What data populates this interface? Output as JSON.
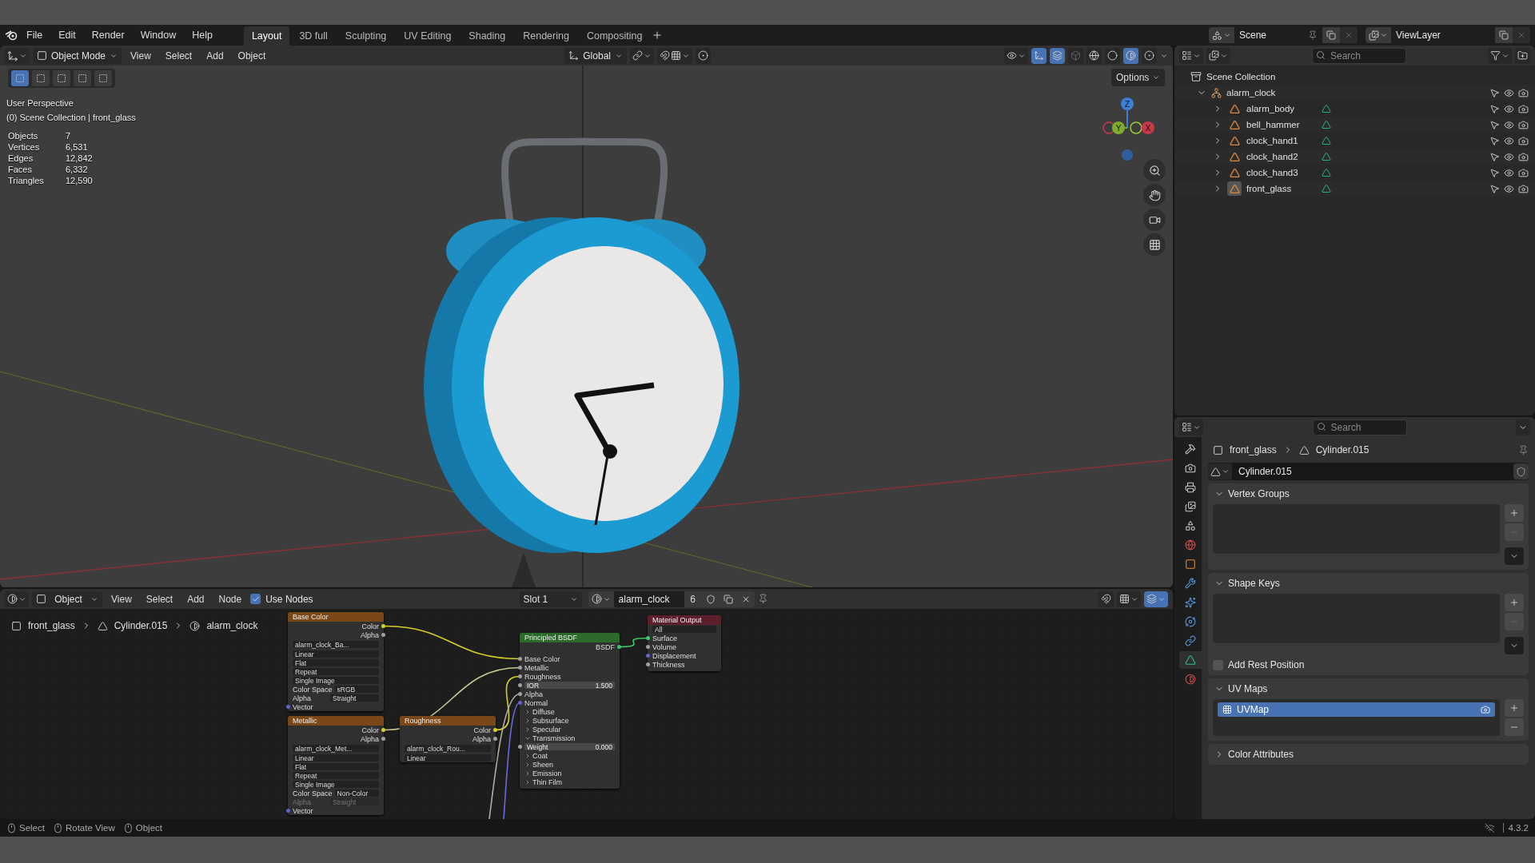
{
  "menu": [
    "File",
    "Edit",
    "Render",
    "Window",
    "Help"
  ],
  "workspaces": [
    {
      "label": "Layout",
      "selected": true
    },
    {
      "label": "3D full",
      "selected": false
    },
    {
      "label": "Sculpting",
      "selected": false
    },
    {
      "label": "UV Editing",
      "selected": false
    },
    {
      "label": "Shading",
      "selected": false
    },
    {
      "label": "Rendering",
      "selected": false
    },
    {
      "label": "Compositing",
      "selected": false
    }
  ],
  "scene": "Scene",
  "view_layer": "ViewLayer",
  "viewport": {
    "mode": "Object Mode",
    "menus": [
      "View",
      "Select",
      "Add",
      "Object"
    ],
    "orientation": "Global",
    "options": "Options",
    "perspective": "User Perspective",
    "context": "(0) Scene Collection | front_glass",
    "select_modes": [
      {
        "selected": true
      },
      {
        "selected": false
      },
      {
        "selected": false
      },
      {
        "selected": false
      },
      {
        "selected": false
      }
    ],
    "shading": [
      {
        "kind": "wireframe",
        "selected": false
      },
      {
        "kind": "solid",
        "selected": false
      },
      {
        "kind": "material",
        "selected": true
      },
      {
        "kind": "rendered",
        "selected": false
      }
    ],
    "stats": [
      {
        "label": "Objects",
        "value": "7"
      },
      {
        "label": "Vertices",
        "value": "6,531"
      },
      {
        "label": "Edges",
        "value": "12,842"
      },
      {
        "label": "Faces",
        "value": "6,332"
      },
      {
        "label": "Triangles",
        "value": "12,590"
      }
    ],
    "gizmo": {
      "z": "Z",
      "y": "Y",
      "x": "X"
    }
  },
  "outliner": {
    "search_placeholder": "Search",
    "root": "Scene Collection",
    "collection": {
      "name": "alarm_clock",
      "expanded": true,
      "children": [
        {
          "name": "alarm_body",
          "expanded": false,
          "selected": false
        },
        {
          "name": "bell_hammer",
          "expanded": false,
          "selected": false
        },
        {
          "name": "clock_hand1",
          "expanded": false,
          "selected": false
        },
        {
          "name": "clock_hand2",
          "expanded": false,
          "selected": false
        },
        {
          "name": "clock_hand3",
          "expanded": false,
          "selected": false
        },
        {
          "name": "front_glass",
          "expanded": false,
          "selected": true
        }
      ]
    }
  },
  "properties": {
    "search_placeholder": "Search",
    "breadcrumb": [
      "front_glass",
      "Cylinder.015"
    ],
    "datablock": "Cylinder.015",
    "tabs": [
      {
        "kind": "tool",
        "selected": false
      },
      {
        "kind": "render",
        "selected": false
      },
      {
        "kind": "output",
        "selected": false
      },
      {
        "kind": "view_layer",
        "selected": false
      },
      {
        "kind": "scene",
        "selected": false
      },
      {
        "kind": "world",
        "selected": false
      },
      {
        "kind": "object",
        "selected": false
      },
      {
        "kind": "modifiers",
        "selected": false
      },
      {
        "kind": "particles",
        "selected": false
      },
      {
        "kind": "physics",
        "selected": false
      },
      {
        "kind": "constraints",
        "selected": false
      },
      {
        "kind": "data",
        "selected": true
      },
      {
        "kind": "material",
        "selected": false
      }
    ],
    "panels": [
      {
        "title": "Vertex Groups",
        "expanded": true
      },
      {
        "title": "Shape Keys",
        "expanded": true,
        "checkbox": {
          "label": "Add Rest Position",
          "checked": false
        }
      },
      {
        "title": "UV Maps",
        "expanded": true,
        "items": [
          {
            "name": "UVMap",
            "selected": true
          }
        ]
      },
      {
        "title": "Color Attributes",
        "expanded": false
      }
    ]
  },
  "node_editor": {
    "type": "Object",
    "menus": [
      "View",
      "Select",
      "Add",
      "Node"
    ],
    "use_nodes": {
      "label": "Use Nodes",
      "checked": true
    },
    "slot": "Slot 1",
    "material": "alarm_clock",
    "users": "6",
    "breadcrumb": [
      "front_glass",
      "Cylinder.015",
      "alarm_clock"
    ],
    "nodes": [
      {
        "title": "Base Color",
        "outputs": [
          "Color",
          "Alpha"
        ],
        "image": "alarm_clock_Ba...",
        "fields": [
          {
            "value": "Linear",
            "disabled": false
          },
          {
            "value": "Flat",
            "disabled": false
          },
          {
            "value": "Repeat",
            "disabled": false
          },
          {
            "value": "Single Image",
            "disabled": false
          },
          {
            "label": "Color Space",
            "value": "sRGB",
            "disabled": false
          },
          {
            "label": "Alpha",
            "value": "Straight",
            "disabled": false
          }
        ],
        "input": "Vector"
      },
      {
        "title": "Metallic",
        "outputs": [
          "Color",
          "Alpha"
        ],
        "image": "alarm_clock_Met...",
        "fields": [
          {
            "value": "Linear",
            "disabled": false
          },
          {
            "value": "Flat",
            "disabled": false
          },
          {
            "value": "Repeat",
            "disabled": false
          },
          {
            "value": "Single Image",
            "disabled": false
          },
          {
            "label": "Color Space",
            "value": "Non-Color",
            "disabled": false
          },
          {
            "label": "Alpha",
            "value": "Straight",
            "disabled": true
          }
        ],
        "input": "Vector"
      },
      {
        "title": "Roughness",
        "outputs": [
          "Color",
          "Alpha"
        ],
        "image": "alarm_clock_Rou...",
        "fields": [
          {
            "value": "Linear",
            "disabled": false
          }
        ]
      },
      {
        "kind": "bsdf",
        "title": "Principled BSDF",
        "outputs": [
          "BSDF"
        ],
        "rows": [
          {
            "kind": "socket",
            "label": "Base Color"
          },
          {
            "kind": "socket",
            "label": "Metallic"
          },
          {
            "kind": "socket",
            "label": "Roughness"
          },
          {
            "kind": "value",
            "label": "IOR",
            "value": "1.500"
          },
          {
            "kind": "socket",
            "label": "Alpha"
          },
          {
            "kind": "socket",
            "label": "Normal"
          },
          {
            "kind": "panel",
            "label": "Diffuse",
            "expanded": false
          },
          {
            "kind": "panel",
            "label": "Subsurface",
            "expanded": false
          },
          {
            "kind": "panel",
            "label": "Specular",
            "expanded": false
          },
          {
            "kind": "panel",
            "label": "Transmission",
            "expanded": true
          },
          {
            "kind": "value",
            "label": "Weight",
            "value": "0.000"
          },
          {
            "kind": "panel",
            "label": "Coat",
            "expanded": false
          },
          {
            "kind": "panel",
            "label": "Sheen",
            "expanded": false
          },
          {
            "kind": "panel",
            "label": "Emission",
            "expanded": false
          },
          {
            "kind": "panel",
            "label": "Thin Film",
            "expanded": false
          }
        ]
      },
      {
        "kind": "output",
        "title": "Material Output",
        "target": "All",
        "rows": [
          {
            "kind": "socket",
            "label": "Surface"
          },
          {
            "kind": "socket",
            "label": "Volume"
          },
          {
            "kind": "socket",
            "label": "Displacement"
          },
          {
            "kind": "socket",
            "label": "Thickness"
          }
        ]
      }
    ]
  },
  "status_bar": {
    "hints": [
      "Select",
      "Rotate View",
      "Object"
    ],
    "version": "4.3.2"
  }
}
